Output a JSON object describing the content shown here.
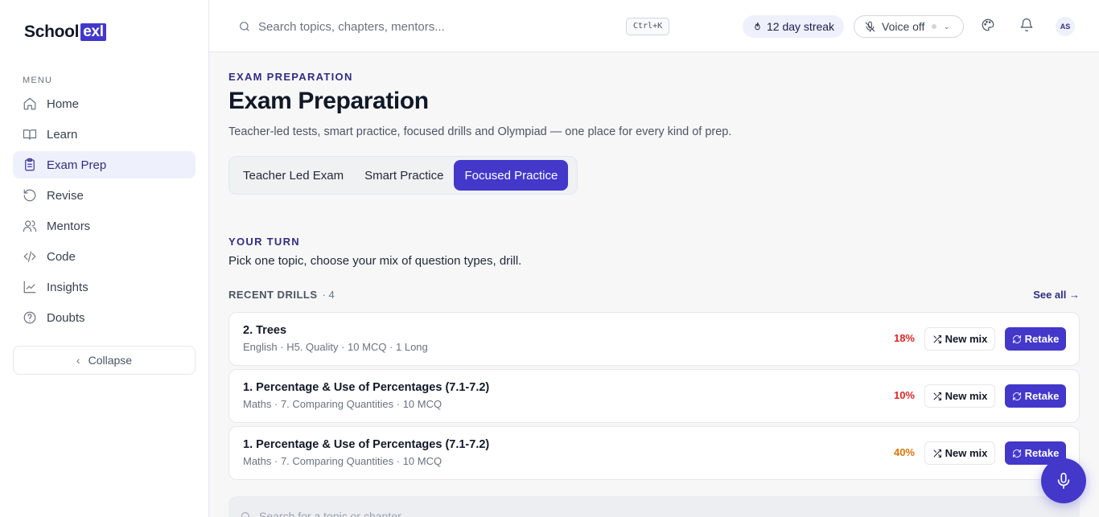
{
  "brand": {
    "name": "School",
    "suffix": "exl"
  },
  "sidebar": {
    "menu_label": "MENU",
    "items": [
      {
        "label": "Home",
        "icon": "home-icon"
      },
      {
        "label": "Learn",
        "icon": "book-icon"
      },
      {
        "label": "Exam Prep",
        "icon": "clipboard-icon",
        "active": true
      },
      {
        "label": "Revise",
        "icon": "rotate-icon"
      },
      {
        "label": "Mentors",
        "icon": "users-icon"
      },
      {
        "label": "Code",
        "icon": "code-icon"
      },
      {
        "label": "Insights",
        "icon": "chart-icon"
      },
      {
        "label": "Doubts",
        "icon": "help-circle-icon"
      }
    ],
    "collapse_label": "Collapse"
  },
  "topbar": {
    "search_placeholder": "Search topics, chapters, mentors...",
    "shortcut": "Ctrl+K",
    "streak": "12 day streak",
    "voice": "Voice off",
    "avatar_initials": "AS"
  },
  "main": {
    "eyebrow": "EXAM PREPARATION",
    "title": "Exam Preparation",
    "subtitle": "Teacher-led tests, smart practice, focused drills and Olympiad — one place for every kind of prep.",
    "tabs": [
      {
        "label": "Teacher Led Exam"
      },
      {
        "label": "Smart Practice"
      },
      {
        "label": "Focused Practice",
        "active": true
      }
    ],
    "your_turn_label": "YOUR TURN",
    "your_turn_desc": "Pick one topic, choose your mix of question types, drill.",
    "recent_label": "RECENT DRILLS",
    "recent_count": "· 4",
    "see_all": "See all →",
    "new_mix_label": "New mix",
    "retake_label": "Retake",
    "drills": [
      {
        "title": "2. Trees",
        "meta": "English · H5. Quality · 10 MCQ · 1 Long",
        "percent": "18%",
        "percent_color": "#dc2626"
      },
      {
        "title": "1. Percentage & Use of Percentages (7.1-7.2)",
        "meta": "Maths · 7. Comparing Quantities · 10 MCQ",
        "percent": "10%",
        "percent_color": "#dc2626"
      },
      {
        "title": "1. Percentage & Use of Percentages (7.1-7.2)",
        "meta": "Maths · 7. Comparing Quantities · 10 MCQ",
        "percent": "40%",
        "percent_color": "#d97706"
      }
    ],
    "bottom_search_placeholder": "Search for a topic or chapter..."
  },
  "colors": {
    "accent": "#4338ca",
    "accent_soft": "#eef0fb"
  }
}
